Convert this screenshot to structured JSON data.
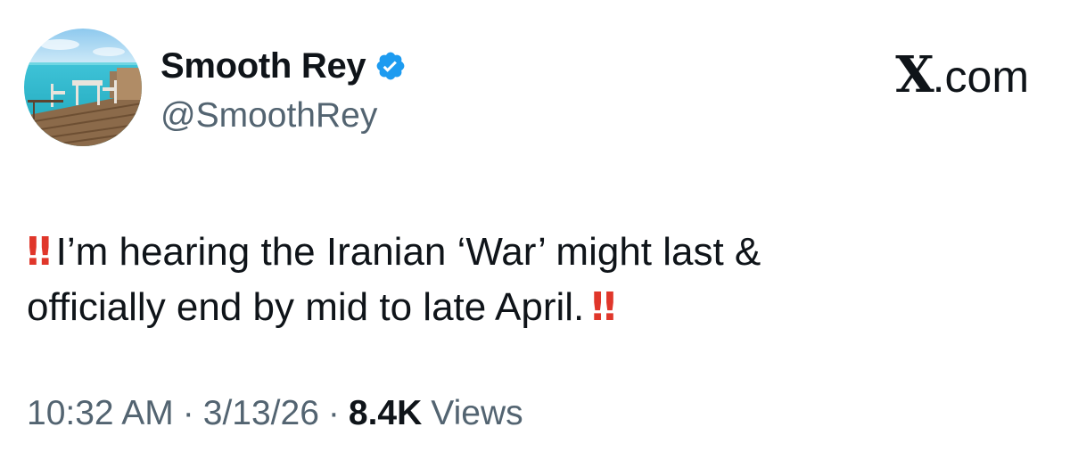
{
  "author": {
    "display_name": "Smooth Rey",
    "handle": "@SmoothRey",
    "verified": true,
    "verified_color": "#1d9bf0"
  },
  "brand": {
    "logo_text": "X",
    "suffix": ".com"
  },
  "tweet": {
    "emoji_lead": "‼",
    "line1": "I’m hearing the Iranian ‘War’ might last &",
    "line2": "officially end by mid to late April.",
    "emoji_trail": "‼",
    "emoji_color": "#e0362a"
  },
  "meta": {
    "time": "10:32 AM",
    "separator": "·",
    "date": "3/13/26",
    "views_count": "8.4K",
    "views_label": "Views"
  },
  "icons": {
    "avatar": "tropical-deck-photo",
    "verified": "verified-badge-icon",
    "emoji": "double-exclamation-icon"
  }
}
